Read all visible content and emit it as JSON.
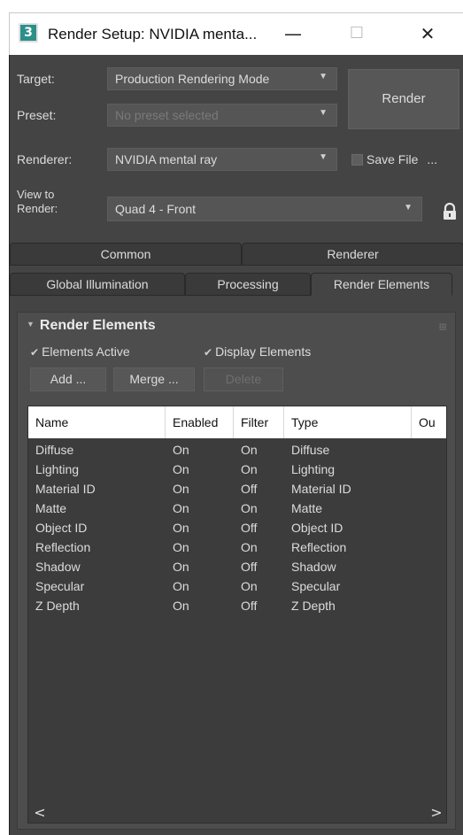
{
  "window": {
    "app_icon_glyph": "3",
    "title": "Render Setup: NVIDIA menta...",
    "minimize_glyph": "—",
    "maximize_glyph": "☐",
    "close_glyph": "✕"
  },
  "settings": {
    "target_label": "Target:",
    "target_value": "Production Rendering Mode",
    "preset_label": "Preset:",
    "preset_value": "No preset selected",
    "renderer_label": "Renderer:",
    "renderer_value": "NVIDIA mental ray",
    "view_label_line1": "View to",
    "view_label_line2": "Render:",
    "view_value": "Quad 4 - Front",
    "render_button": "Render",
    "save_file_label": "Save File",
    "more_button": "..."
  },
  "tabs": {
    "row1": [
      "Common",
      "Renderer"
    ],
    "row2": [
      "Global Illumination",
      "Processing",
      "Render Elements"
    ],
    "active": "Render Elements"
  },
  "rollout": {
    "title": "Render Elements",
    "elements_active_label": "Elements Active",
    "display_elements_label": "Display Elements",
    "add_button": "Add ...",
    "merge_button": "Merge ...",
    "delete_button": "Delete"
  },
  "table": {
    "columns": [
      "Name",
      "Enabled",
      "Filter",
      "Type",
      "Ou"
    ],
    "rows": [
      [
        "Diffuse",
        "On",
        "On",
        "Diffuse"
      ],
      [
        "Lighting",
        "On",
        "On",
        "Lighting"
      ],
      [
        "Material ID",
        "On",
        "Off",
        "Material ID"
      ],
      [
        "Matte",
        "On",
        "On",
        "Matte"
      ],
      [
        "Object ID",
        "On",
        "Off",
        "Object ID"
      ],
      [
        "Reflection",
        "On",
        "On",
        "Reflection"
      ],
      [
        "Shadow",
        "On",
        "Off",
        "Shadow"
      ],
      [
        "Specular",
        "On",
        "On",
        "Specular"
      ],
      [
        "Z Depth",
        "On",
        "Off",
        "Z Depth"
      ]
    ],
    "scroll_left": "<",
    "scroll_right": ">"
  },
  "colors": {
    "panel_bg": "#444444",
    "accent_icon": "#2c8f8a"
  }
}
